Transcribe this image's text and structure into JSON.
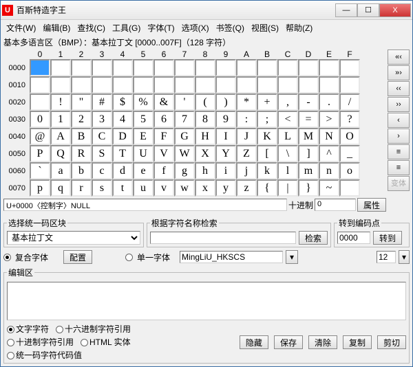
{
  "window": {
    "title": "百斯特造字王"
  },
  "menu": {
    "items": [
      "文件(W)",
      "编辑(B)",
      "查找(C)",
      "工具(G)",
      "字体(T)",
      "选项(X)",
      "书签(Q)",
      "视图(S)",
      "帮助(Z)"
    ]
  },
  "bmp_label": "基本多语言区（BMP）：基本拉丁文 [0000..007F]（128 字符）",
  "col_headers": [
    "0",
    "1",
    "2",
    "3",
    "4",
    "5",
    "6",
    "7",
    "8",
    "9",
    "A",
    "B",
    "C",
    "D",
    "E",
    "F"
  ],
  "grid_rows": [
    {
      "h": "0000",
      "c": [
        "",
        "",
        "",
        "",
        "",
        "",
        "",
        "",
        "",
        "",
        "",
        "",
        "",
        "",
        "",
        ""
      ]
    },
    {
      "h": "0010",
      "c": [
        "",
        "",
        "",
        "",
        "",
        "",
        "",
        "",
        "",
        "",
        "",
        "",
        "",
        "",
        "",
        ""
      ]
    },
    {
      "h": "0020",
      "c": [
        "",
        "!",
        "\"",
        "#",
        "$",
        "%",
        "&",
        "'",
        "(",
        ")",
        "*",
        "+",
        ",",
        "-",
        ".",
        "/"
      ]
    },
    {
      "h": "0030",
      "c": [
        "0",
        "1",
        "2",
        "3",
        "4",
        "5",
        "6",
        "7",
        "8",
        "9",
        ":",
        ";",
        "<",
        "=",
        ">",
        "?"
      ]
    },
    {
      "h": "0040",
      "c": [
        "@",
        "A",
        "B",
        "C",
        "D",
        "E",
        "F",
        "G",
        "H",
        "I",
        "J",
        "K",
        "L",
        "M",
        "N",
        "O"
      ]
    },
    {
      "h": "0050",
      "c": [
        "P",
        "Q",
        "R",
        "S",
        "T",
        "U",
        "V",
        "W",
        "X",
        "Y",
        "Z",
        "[",
        "\\",
        "]",
        "^",
        "_"
      ]
    },
    {
      "h": "0060",
      "c": [
        "`",
        "a",
        "b",
        "c",
        "d",
        "e",
        "f",
        "g",
        "h",
        "i",
        "j",
        "k",
        "l",
        "m",
        "n",
        "o"
      ]
    },
    {
      "h": "0070",
      "c": [
        "p",
        "q",
        "r",
        "s",
        "t",
        "u",
        "v",
        "w",
        "x",
        "y",
        "z",
        "{",
        "|",
        "}",
        "~",
        ""
      ]
    }
  ],
  "selected": [
    0,
    0
  ],
  "side_buttons": [
    "«‹",
    "»›",
    "‹‹",
    "››",
    "‹",
    "›",
    "≡",
    "≡",
    "变体"
  ],
  "status": {
    "code": "U+0000〈控制字〉NULL",
    "dec_label": "十进制",
    "dec_value": "0",
    "prop_btn": "属性"
  },
  "block_sel": {
    "legend": "选择统一码区块",
    "value": "基本拉丁文"
  },
  "search": {
    "legend": "根据字符名称检索",
    "value": "",
    "btn": "检索"
  },
  "goto": {
    "legend": "转到编码点",
    "value": "0000",
    "btn": "转到"
  },
  "font_mode": {
    "composite": "复合字体",
    "config_btn": "配置",
    "single": "单一字体",
    "font_value": "MingLiU_HKSCS",
    "size": "12"
  },
  "edit_area": {
    "legend": "编辑区"
  },
  "char_mode": {
    "opts": [
      "文字字符",
      "十六进制字符引用",
      "十进制字符引用",
      "HTML 实体",
      "统一码字符代码值"
    ],
    "selected": 0
  },
  "bottom_btns": [
    "隐藏",
    "保存",
    "清除",
    "复制",
    "剪切"
  ],
  "winbtns": {
    "min": "—",
    "max": "☐",
    "close": "X"
  }
}
